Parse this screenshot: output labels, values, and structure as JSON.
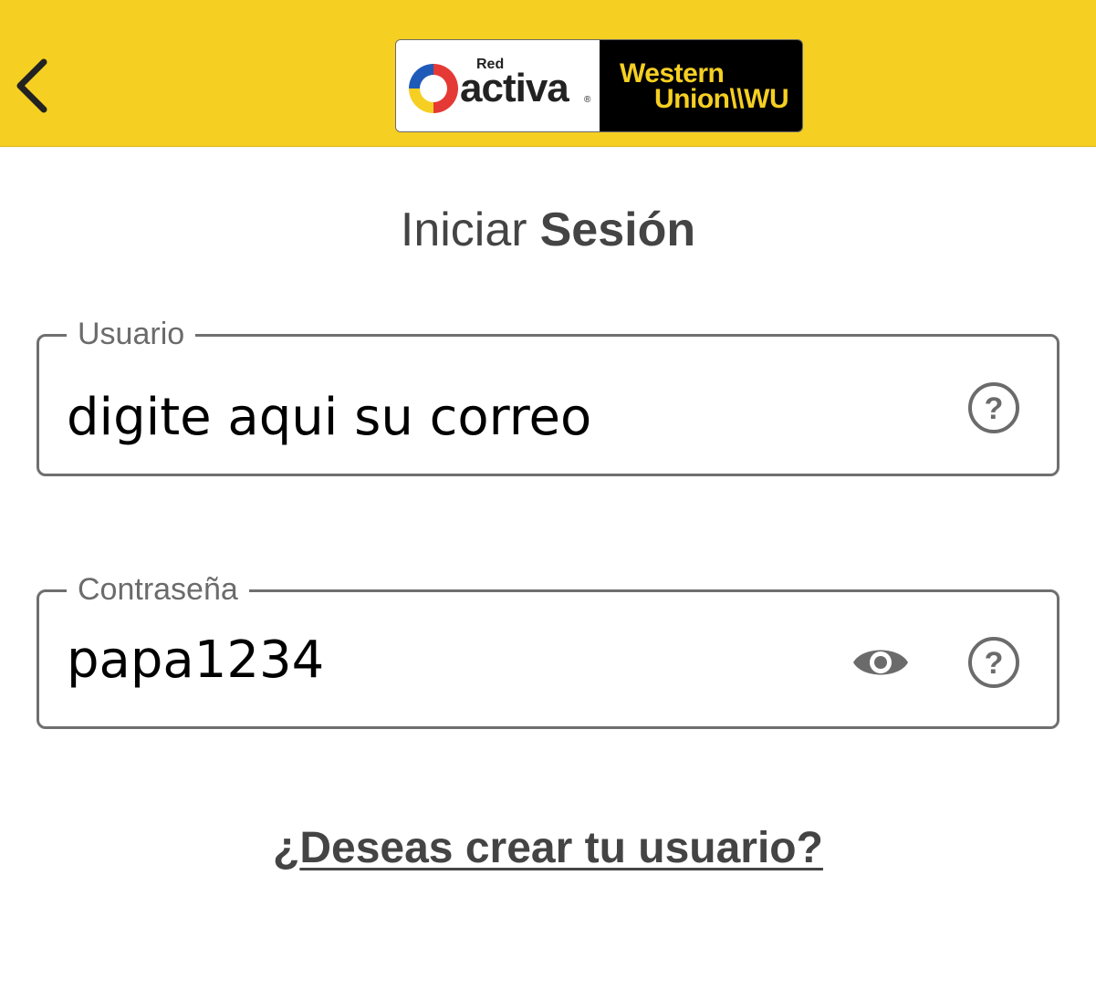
{
  "header": {
    "logo": {
      "brand_left_small": "Red",
      "brand_left": "activa",
      "brand_left_mark": "®",
      "brand_right_line1": "Western",
      "brand_right_line2": "Union\\\\WU"
    },
    "back_icon": "chevron-left-icon"
  },
  "title": {
    "light": "Iniciar",
    "bold": "Sesión"
  },
  "form": {
    "user": {
      "label": "Usuario",
      "placeholder": "digite aqui su correo",
      "value": ""
    },
    "password": {
      "label": "Contraseña",
      "value": "papa1234"
    }
  },
  "create_user_link": {
    "prefix": "¿",
    "text": "Deseas crear tu usuario?"
  },
  "colors": {
    "header_bg": "#f5cf22",
    "text_dark": "#444444",
    "border": "#6f6f6f"
  }
}
